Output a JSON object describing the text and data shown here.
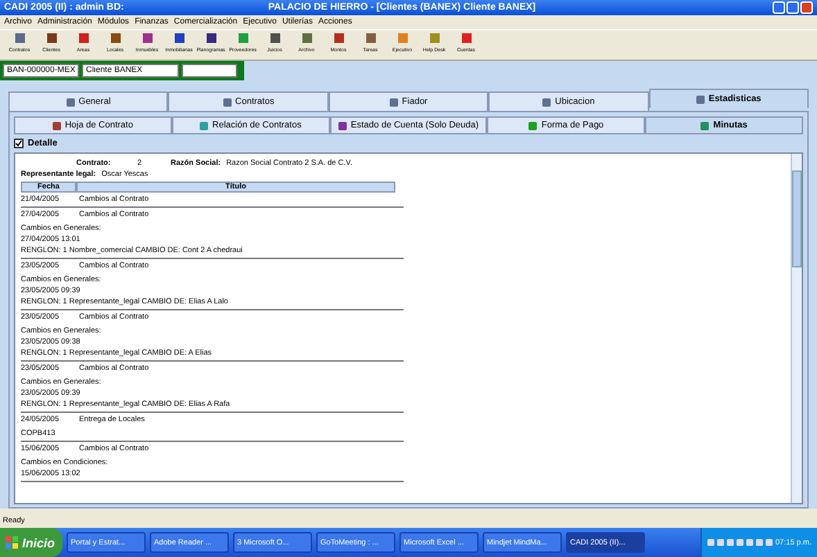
{
  "window": {
    "title_left": "CADI  2005 (II) : admin   BD:",
    "title": "PALACIO DE HIERRO - [Clientes (BANEX) Cliente BANEX]"
  },
  "menu": [
    "Archivo",
    "Administración",
    "Módulos",
    "Finanzas",
    "Comercialización",
    "Ejecutivo",
    "Utilerías",
    "Acciones"
  ],
  "toolbar": [
    {
      "label": "Contratos",
      "color": "#5a6b8c"
    },
    {
      "label": "Clientes",
      "color": "#7a3a1a"
    },
    {
      "label": "Areas",
      "color": "#d02020"
    },
    {
      "label": "Locales",
      "color": "#8a4a10"
    },
    {
      "label": "Inmuebles",
      "color": "#a03090"
    },
    {
      "label": "Inmobiliarias",
      "color": "#2040c0"
    },
    {
      "label": "Planogramas",
      "color": "#3a2a80"
    },
    {
      "label": "Proveedores",
      "color": "#20a040"
    },
    {
      "label": "Juicios",
      "color": "#505050"
    },
    {
      "label": "Archivo",
      "color": "#607040"
    },
    {
      "label": "Montos",
      "color": "#b03020"
    },
    {
      "label": "Tareas",
      "color": "#806040"
    },
    {
      "label": "Ejecutivo",
      "color": "#e08020"
    },
    {
      "label": "Help Desk",
      "color": "#a09020"
    },
    {
      "label": "Cuentas",
      "color": "#e02020"
    }
  ],
  "header_fields": [
    {
      "value": "BAN-000000-MEX"
    },
    {
      "value": "Cliente BANEX"
    }
  ],
  "tabs": [
    {
      "label": "General",
      "selected": false
    },
    {
      "label": "Contratos",
      "selected": false
    },
    {
      "label": "Fiador",
      "selected": false
    },
    {
      "label": "Ubicacion",
      "selected": false
    },
    {
      "label": "Estadisticas",
      "selected": true
    }
  ],
  "subtabs": [
    {
      "label": "Hoja de Contrato",
      "selected": false
    },
    {
      "label": "Relación de Contratos",
      "selected": false
    },
    {
      "label": "Estado de Cuenta (Solo Deuda)",
      "selected": false
    },
    {
      "label": "Forma de Pago",
      "selected": false
    },
    {
      "label": "Minutas",
      "selected": true
    }
  ],
  "detalle": {
    "label": "Detalle",
    "checked": true
  },
  "summary": {
    "contrato_label": "Contrato:",
    "contrato": "2",
    "razon_label": "Razón Social:",
    "razon": "Razon Social Contrato 2 S.A. de C.V.",
    "rep_label": "Representante legal:",
    "rep": "Oscar Yescas"
  },
  "columns": [
    "Fecha",
    "Título"
  ],
  "records": [
    {
      "date": "21/04/2005",
      "title": "Cambios al Contrato"
    },
    {
      "date": "27/04/2005",
      "title": "Cambios al Contrato",
      "details": [
        "Cambios en Generales:",
        "27/04/2005 13:01",
        "RENGLON: 1 Nombre_comercial CAMBIO DE: Cont 2 A chedraui"
      ]
    },
    {
      "date": "23/05/2005",
      "title": "Cambios al Contrato",
      "details": [
        "Cambios en Generales:",
        "23/05/2005 09:39",
        "RENGLON: 1 Representante_legal CAMBIO DE: Elias A Lalo"
      ]
    },
    {
      "date": "23/05/2005",
      "title": "Cambios al Contrato",
      "details": [
        "Cambios en Generales:",
        "23/05/2005 09:38",
        "RENGLON: 1 Representante_legal CAMBIO DE:  A Elias"
      ]
    },
    {
      "date": "23/05/2005",
      "title": "Cambios al Contrato",
      "details": [
        "Cambios en Generales:",
        "23/05/2005 09:39",
        "RENGLON: 1 Representante_legal CAMBIO DE: Elias A Rafa"
      ]
    },
    {
      "date": "24/05/2005",
      "title": "Entrega de Locales",
      "details": [
        "COPB413"
      ]
    },
    {
      "date": "15/06/2005",
      "title": "Cambios al Contrato",
      "details": [
        "Cambios en Condiciones:",
        "15/06/2005 13:02"
      ]
    }
  ],
  "status_bar": "Ready",
  "taskbar": {
    "start": "Inicio",
    "items": [
      {
        "label": "Portal y Estrat...",
        "selected": false
      },
      {
        "label": "Adobe Reader ...",
        "selected": false
      },
      {
        "label": "3 Microsoft O...",
        "selected": false
      },
      {
        "label": "GoToMeeting : ...",
        "selected": false
      },
      {
        "label": "Microsoft Excel ...",
        "selected": false
      },
      {
        "label": "Mindjet MindMa...",
        "selected": false
      },
      {
        "label": "CADI  2005 (II)...",
        "selected": true
      }
    ],
    "clock": "07:15 p.m."
  }
}
